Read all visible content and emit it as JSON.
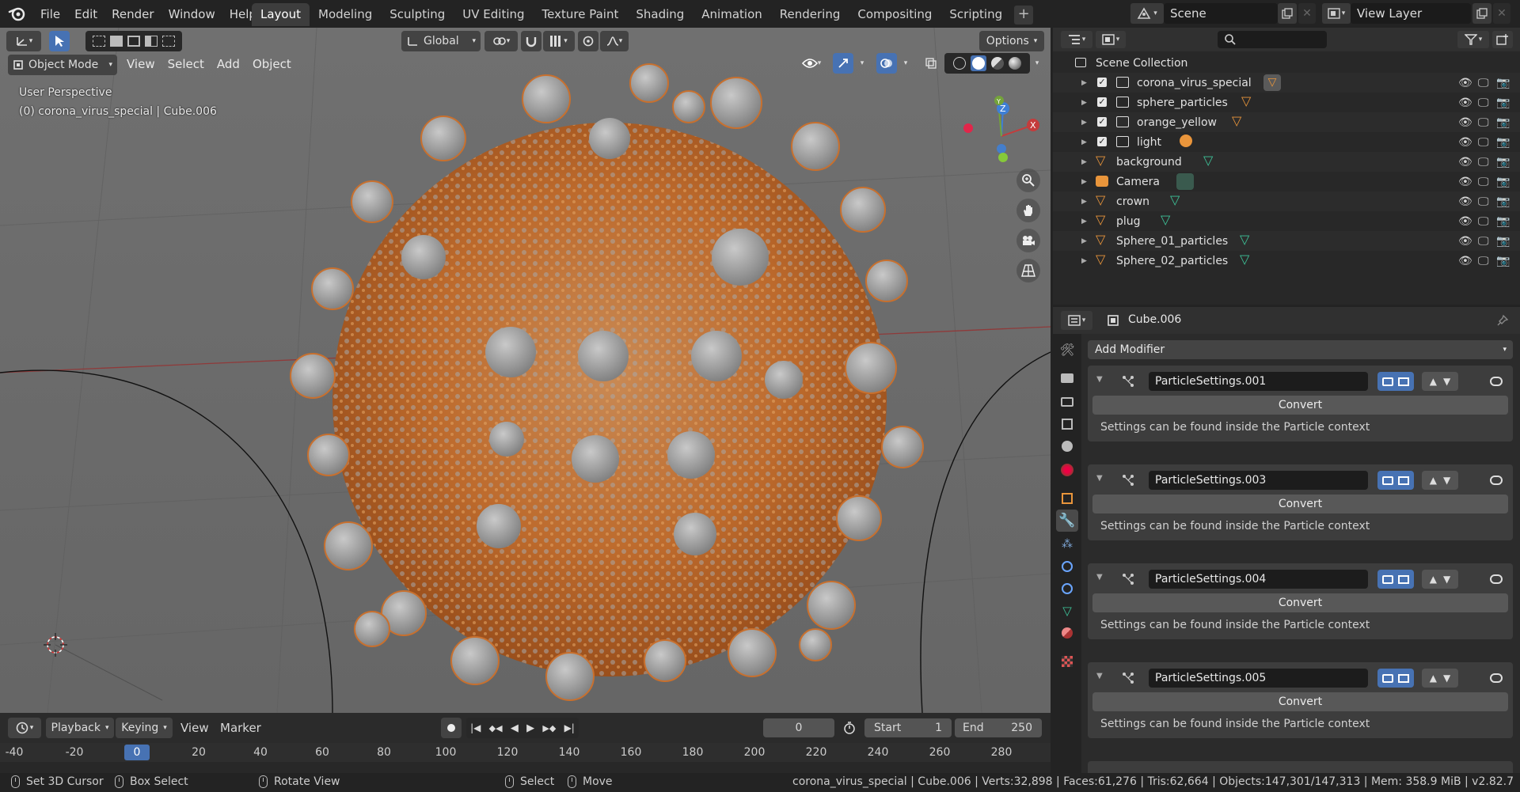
{
  "topbar": {
    "menus": [
      "File",
      "Edit",
      "Render",
      "Window",
      "Help"
    ],
    "tabs": [
      "Layout",
      "Modeling",
      "Sculpting",
      "UV Editing",
      "Texture Paint",
      "Shading",
      "Animation",
      "Rendering",
      "Compositing",
      "Scripting"
    ],
    "active_tab": "Layout",
    "add_tab": "+",
    "scene": "Scene",
    "view_layer": "View Layer"
  },
  "viewport": {
    "transform_orientation": "Global",
    "options_label": "Options",
    "mode": "Object Mode",
    "menus": [
      "View",
      "Select",
      "Add",
      "Object"
    ],
    "perspective_label": "User Perspective",
    "context_label": "(0) corona_virus_special | Cube.006",
    "axis_labels": {
      "x": "X",
      "y": "Y",
      "z": "Z"
    }
  },
  "timeline": {
    "menus": [
      "Playback",
      "Keying",
      "View",
      "Marker"
    ],
    "current_frame": "0",
    "start_label": "Start",
    "start_value": "1",
    "end_label": "End",
    "end_value": "250",
    "ruler": [
      "-40",
      "-20",
      "0",
      "20",
      "40",
      "60",
      "80",
      "100",
      "120",
      "140",
      "160",
      "180",
      "200",
      "220",
      "240",
      "260",
      "280"
    ]
  },
  "statusbar": {
    "items": [
      "Set 3D Cursor",
      "Box Select",
      "Rotate View",
      "Select",
      "Move"
    ],
    "stats": "corona_virus_special | Cube.006 | Verts:32,898 | Faces:61,276 | Tris:62,664 | Objects:147,301/147,313 | Mem: 358.9 MiB | v2.82.7"
  },
  "outliner": {
    "root": "Scene Collection",
    "collections": [
      {
        "name": "corona_virus_special"
      },
      {
        "name": "sphere_particles"
      },
      {
        "name": "orange_yellow"
      },
      {
        "name": "light"
      }
    ],
    "objects": [
      {
        "name": "background",
        "type": "mesh"
      },
      {
        "name": "Camera",
        "type": "camera"
      },
      {
        "name": "crown",
        "type": "mesh"
      },
      {
        "name": "plug",
        "type": "mesh"
      },
      {
        "name": "Sphere_01_particles",
        "type": "mesh"
      },
      {
        "name": "Sphere_02_particles",
        "type": "mesh"
      }
    ]
  },
  "properties": {
    "object_name": "Cube.006",
    "add_modifier": "Add Modifier",
    "modifiers": [
      {
        "name": "ParticleSettings.001",
        "convert": "Convert",
        "note": "Settings can be found inside the Particle context"
      },
      {
        "name": "ParticleSettings.003",
        "convert": "Convert",
        "note": "Settings can be found inside the Particle context"
      },
      {
        "name": "ParticleSettings.004",
        "convert": "Convert",
        "note": "Settings can be found inside the Particle context"
      },
      {
        "name": "ParticleSettings.005",
        "convert": "Convert",
        "note": "Settings can be found inside the Particle context"
      }
    ]
  },
  "colors": {
    "accent_blue": "#4772b3",
    "virus_orange": "#c8702e",
    "spike_grey": "#9a9a9a",
    "mesh_icon_orange": "#e9953b",
    "data_icon_green": "#3ec49a"
  }
}
